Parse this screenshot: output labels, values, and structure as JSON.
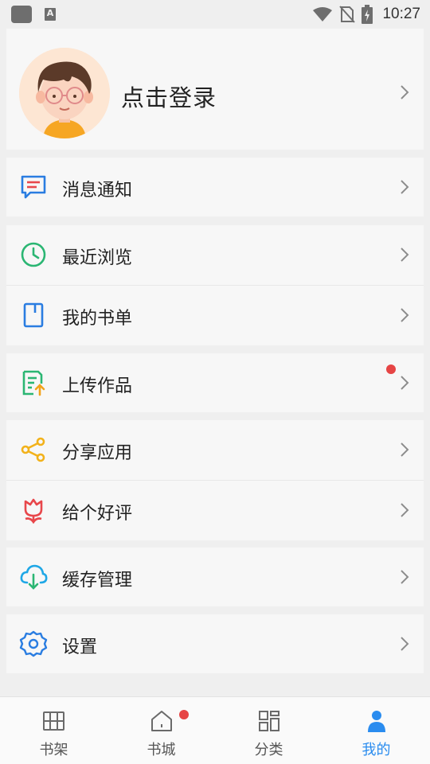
{
  "status_bar": {
    "time": "10:27",
    "icons": [
      "app-icon",
      "a-icon",
      "wifi-icon",
      "no-sim-icon",
      "battery-charging-icon"
    ]
  },
  "profile": {
    "login_label": "点击登录",
    "avatar": "avatar-boy-with-glasses"
  },
  "menu_groups": [
    [
      {
        "id": "messages",
        "label": "消息通知",
        "icon": "message-icon",
        "color": "#2a7de1"
      }
    ],
    [
      {
        "id": "recent",
        "label": "最近浏览",
        "icon": "clock-icon",
        "color": "#2bb673"
      },
      {
        "id": "booklist",
        "label": "我的书单",
        "icon": "book-icon",
        "color": "#2a7de1"
      }
    ],
    [
      {
        "id": "upload",
        "label": "上传作品",
        "icon": "upload-doc-icon",
        "color": "#2bb673",
        "badge": true
      }
    ],
    [
      {
        "id": "share",
        "label": "分享应用",
        "icon": "share-icon",
        "color": "#f2b21b"
      },
      {
        "id": "rate",
        "label": "给个好评",
        "icon": "flower-icon",
        "color": "#e8474b"
      }
    ],
    [
      {
        "id": "cache",
        "label": "缓存管理",
        "icon": "cloud-download-icon",
        "color": "#1fa7e6"
      }
    ],
    [
      {
        "id": "settings",
        "label": "设置",
        "icon": "gear-icon",
        "color": "#2a7de1"
      }
    ]
  ],
  "bottom_nav": [
    {
      "label": "书架",
      "icon": "bookshelf-icon",
      "active": false,
      "badge": false
    },
    {
      "label": "书城",
      "icon": "home-icon",
      "active": false,
      "badge": true
    },
    {
      "label": "分类",
      "icon": "grid-icon",
      "active": false,
      "badge": false
    },
    {
      "label": "我的",
      "icon": "person-icon",
      "active": true,
      "badge": false
    }
  ],
  "colors": {
    "accent": "#2a8cef",
    "badge": "#e64545",
    "background": "#efefef",
    "card": "#f7f7f7"
  }
}
